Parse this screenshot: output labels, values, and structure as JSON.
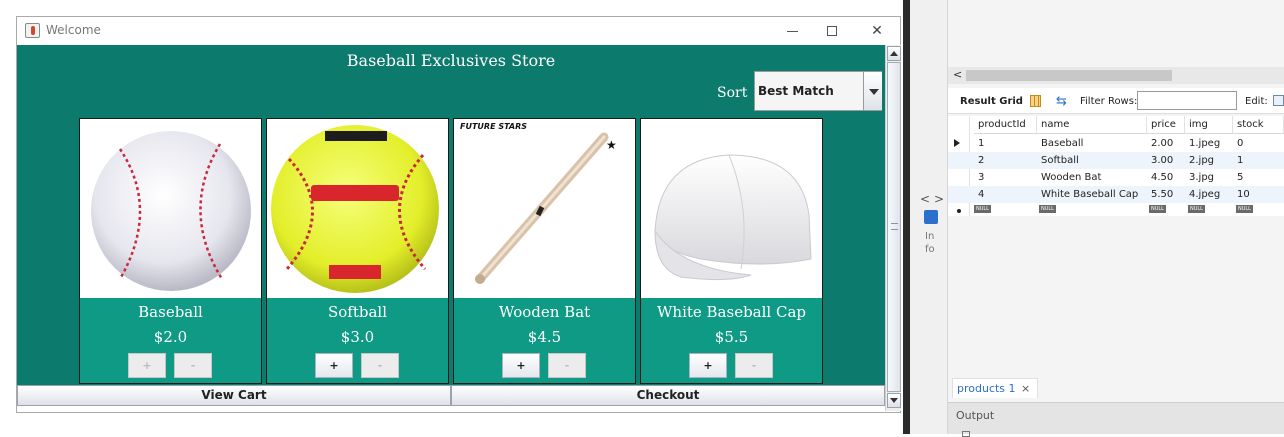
{
  "window": {
    "title": "Welcome"
  },
  "store": {
    "title": "Baseball Exclusives Store",
    "sort_label": "Sort",
    "sort_value": "Best Match",
    "plus_label": "+",
    "minus_label": "-",
    "products": [
      {
        "name": "Baseball",
        "price": "$2.0",
        "image": "baseball-image",
        "plus_enabled": false,
        "minus_enabled": false
      },
      {
        "name": "Softball",
        "price": "$3.0",
        "image": "softball-image",
        "plus_enabled": true,
        "minus_enabled": false
      },
      {
        "name": "Wooden Bat",
        "price": "$4.5",
        "image": "wooden-bat-image",
        "image_brand_text": "FUTURE STARS",
        "plus_enabled": true,
        "minus_enabled": false
      },
      {
        "name": "White Baseball Cap",
        "price": "$5.5",
        "image": "white-cap-image",
        "plus_enabled": true,
        "minus_enabled": false
      }
    ],
    "view_cart_label": "View Cart",
    "checkout_label": "Checkout"
  },
  "workbench": {
    "toolbar": {
      "result_grid_label": "Result Grid",
      "filter_rows_label": "Filter Rows:",
      "filter_rows_value": "",
      "edit_label": "Edit:"
    },
    "side_strip": {
      "left_arrow": "<",
      "right_arrow": ">",
      "info_text": "In fo"
    },
    "grid": {
      "columns": [
        "productId",
        "name",
        "price",
        "img",
        "stock"
      ],
      "rows": [
        [
          "1",
          "Baseball",
          "2.00",
          "1.jpeg",
          "0"
        ],
        [
          "2",
          "Softball",
          "3.00",
          "2.jpg",
          "1"
        ],
        [
          "3",
          "Wooden Bat",
          "4.50",
          "3.jpg",
          "5"
        ],
        [
          "4",
          "White Baseball Cap",
          "5.50",
          "4.jpeg",
          "10"
        ]
      ],
      "null_label": "NULL"
    },
    "result_tab": {
      "label": "products 1",
      "close": "×"
    },
    "output_label": "Output"
  },
  "colors": {
    "store_background": "#0d7a6e",
    "card_footer": "#0f9a86",
    "accent_blue": "#2d6fcc"
  }
}
